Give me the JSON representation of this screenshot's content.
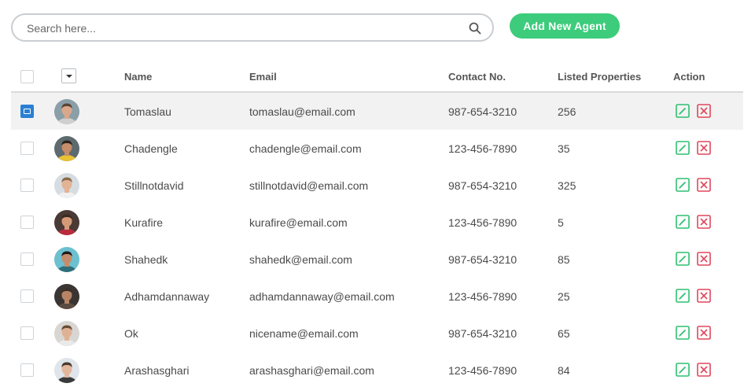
{
  "search": {
    "placeholder": "Search here..."
  },
  "toolbar": {
    "add_label": "Add New Agent"
  },
  "columns": {
    "name": "Name",
    "email": "Email",
    "contact": "Contact No.",
    "listed": "Listed Properties",
    "action": "Action"
  },
  "colors": {
    "accent_green": "#3ccc7b",
    "edit_green": "#2fbf71",
    "delete_red": "#e0475b",
    "selected_blue": "#2a7fd4"
  },
  "rows": [
    {
      "name": "Tomaslau",
      "email": "tomaslau@email.com",
      "contact": "987-654-3210",
      "listed": "256",
      "selected": true,
      "avatar": {
        "skin": "#d9a88a",
        "hair": "#5a4535",
        "shirt": "#cfcfcf",
        "bg": "#8a9fa8"
      }
    },
    {
      "name": "Chadengle",
      "email": "chadengle@email.com",
      "contact": "123-456-7890",
      "listed": "35",
      "selected": false,
      "avatar": {
        "skin": "#c58d6a",
        "hair": "#2a241f",
        "shirt": "#e8c234",
        "bg": "#5d6a6e"
      }
    },
    {
      "name": "Stillnotdavid",
      "email": "stillnotdavid@email.com",
      "contact": "987-654-3210",
      "listed": "325",
      "selected": false,
      "avatar": {
        "skin": "#e3b395",
        "hair": "#8a6b4a",
        "shirt": "#f1f1f1",
        "bg": "#d6dde2"
      }
    },
    {
      "name": "Kurafire",
      "email": "kurafire@email.com",
      "contact": "123-456-7890",
      "listed": "5",
      "selected": false,
      "avatar": {
        "skin": "#d59a78",
        "hair": "#3a2a22",
        "shirt": "#b92b3d",
        "bg": "#4a3a36"
      }
    },
    {
      "name": "Shahedk",
      "email": "shahedk@email.com",
      "contact": "987-654-3210",
      "listed": "85",
      "selected": false,
      "avatar": {
        "skin": "#c58c6b",
        "hair": "#1f1c1a",
        "shirt": "#2f6f7c",
        "bg": "#6cc0d0"
      }
    },
    {
      "name": "Adhamdannaway",
      "email": "adhamdannaway@email.com",
      "contact": "123-456-7890",
      "listed": "25",
      "selected": false,
      "avatar": {
        "skin": "#b88466",
        "hair": "#3b2f28",
        "shirt": "#5a4a40",
        "bg": "#3a3532"
      }
    },
    {
      "name": "Ok",
      "email": "nicename@email.com",
      "contact": "987-654-3210",
      "listed": "65",
      "selected": false,
      "avatar": {
        "skin": "#e0b295",
        "hair": "#6a4c35",
        "shirt": "#e9e9e9",
        "bg": "#d8d6d2"
      }
    },
    {
      "name": "Arashasghari",
      "email": "arashasghari@email.com",
      "contact": "123-456-7890",
      "listed": "84",
      "selected": false,
      "avatar": {
        "skin": "#e2b79c",
        "hair": "#4a3a30",
        "shirt": "#3a3a3a",
        "bg": "#dfe5ea"
      }
    }
  ]
}
